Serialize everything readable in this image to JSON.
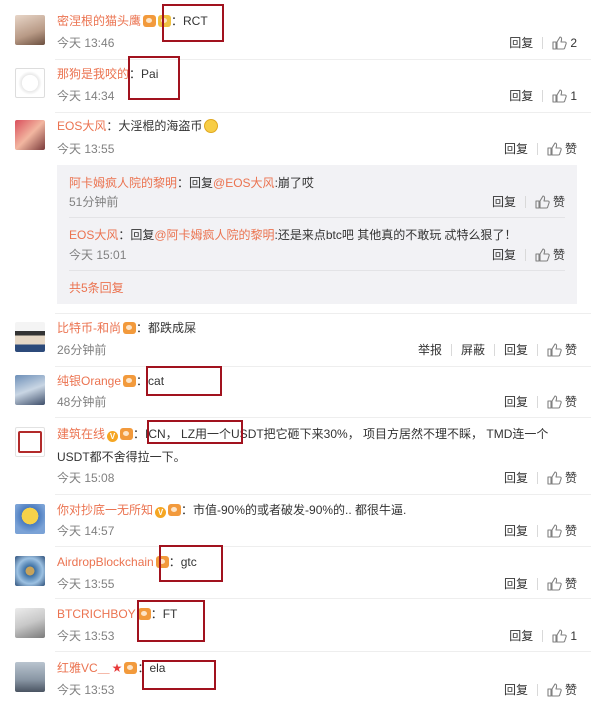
{
  "comments": [
    {
      "username": "密涅根的猫头鹰",
      "text": "：RCT",
      "time": "今天 13:46",
      "reply": "回复",
      "likes": "2"
    },
    {
      "username": "那狗是我咬的",
      "text": "：Pai",
      "time": "今天 14:34",
      "reply": "回复",
      "likes": "1"
    },
    {
      "username": "EOS大风",
      "text": "：大淫棍的海盗币",
      "time": "今天 13:55",
      "reply": "回复",
      "likes": "赞"
    },
    {
      "username": "比特币-和尚",
      "text": "：都跌成屎",
      "time": "26分钟前",
      "report": "举报",
      "block": "屏蔽",
      "reply": "回复",
      "likes": "赞"
    },
    {
      "username": "纯银Orange",
      "text": "：cat",
      "time": "48分钟前",
      "reply": "回复",
      "likes": "赞"
    },
    {
      "username": "建筑在线",
      "text": "：ICN， LZ用一个USDT把它砸下来30%， 项目方居然不理不睬， TMD连一个",
      "text2": "USDT都不舍得拉一下。",
      "time": "今天 15:08",
      "reply": "回复",
      "likes": "赞"
    },
    {
      "username": "你对抄底一无所知",
      "text": "：市值-90%的或者破发-90%的.. 都很牛逼.",
      "time": "今天 14:57",
      "reply": "回复",
      "likes": "赞"
    },
    {
      "username": "AirdropBlockchain",
      "text": "：gtc",
      "time": "今天 13:55",
      "reply": "回复",
      "likes": "赞"
    },
    {
      "username": "BTCRICHBOY",
      "text": "：FT",
      "time": "今天 13:53",
      "reply": "回复",
      "likes": "1"
    },
    {
      "username": "红雅VC＿",
      "text": "：ela",
      "time": "今天 13:53",
      "reply": "回复",
      "likes": "赞"
    }
  ],
  "replies": [
    {
      "username": "阿卡姆疯人院的黎明",
      "prefix": "：回复",
      "mention": "@EOS大风",
      "text": ":崩了哎",
      "time": "51分钟前",
      "reply": "回复",
      "likes": "赞"
    },
    {
      "username": "EOS大风",
      "prefix": "：回复",
      "mention": "@阿卡姆疯人院的黎明",
      "text": ":还是来点btc吧  其他真的不敢玩  忒特么狠了！",
      "time": "今天 15:01",
      "reply": "回复",
      "likes": "赞"
    }
  ],
  "more_replies": "共5条回复",
  "colors": {
    "username": "#eb7350",
    "highlight_box": "#a1121e",
    "reply_bg": "#f2f2f5"
  }
}
